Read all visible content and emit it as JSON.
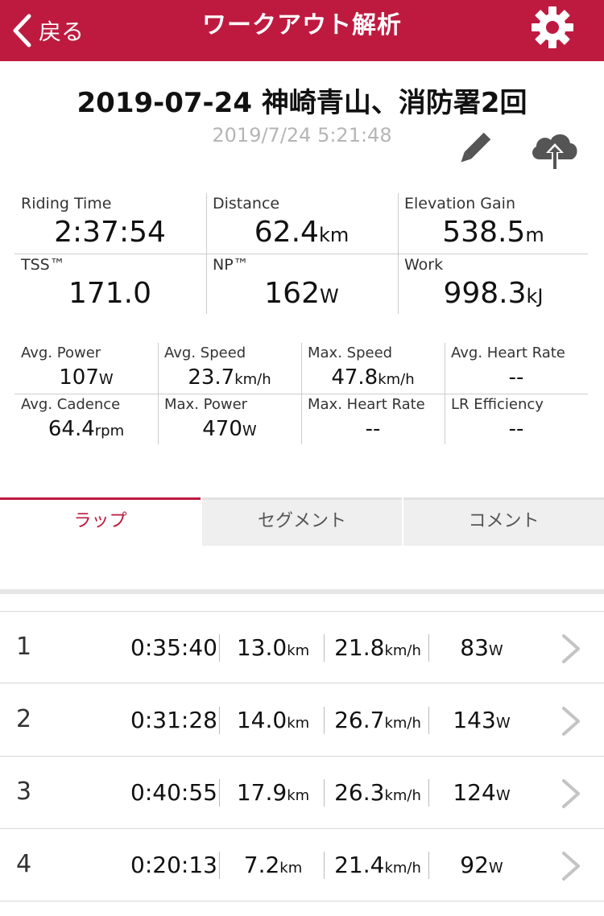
{
  "nav": {
    "back_label": "戻る",
    "title": "ワークアウト解析",
    "bar_color": "#be1a3f"
  },
  "workout": {
    "title": "2019-07-24 神崎青山、消防署2回",
    "datetime": "2019/7/24 5:21:48",
    "icons": [
      "pencil-icon",
      "cloud-upload-icon",
      "gear-icon"
    ]
  },
  "big_stats": [
    {
      "label": "Riding Time",
      "value": "2:37:54",
      "unit": ""
    },
    {
      "label": "Distance",
      "value": "62.4",
      "unit": "km"
    },
    {
      "label": "Elevation Gain",
      "value": "538.5",
      "unit": "m"
    },
    {
      "label": "TSS™",
      "value": "171.0",
      "unit": ""
    },
    {
      "label": "NP™",
      "value": "162",
      "unit": "W"
    },
    {
      "label": "Work",
      "value": "998.3",
      "unit": "kJ"
    }
  ],
  "small_stats": [
    {
      "label": "Avg. Power",
      "value": "107",
      "unit": "W"
    },
    {
      "label": "Avg. Speed",
      "value": "23.7",
      "unit": "km/h"
    },
    {
      "label": "Max. Speed",
      "value": "47.8",
      "unit": "km/h"
    },
    {
      "label": "Avg. Heart Rate",
      "value": "--",
      "unit": ""
    },
    {
      "label": "Avg. Cadence",
      "value": "64.4",
      "unit": "rpm"
    },
    {
      "label": "Max. Power",
      "value": "470",
      "unit": "W"
    },
    {
      "label": "Max. Heart Rate",
      "value": "--",
      "unit": ""
    },
    {
      "label": "LR Efficiency",
      "value": "--",
      "unit": ""
    }
  ],
  "tabs": [
    {
      "label": "ラップ",
      "active": true
    },
    {
      "label": "セグメント",
      "active": false
    },
    {
      "label": "コメント",
      "active": false
    }
  ],
  "laps": [
    {
      "num": "1",
      "time": "0:35:40",
      "dist": "13.0",
      "dist_unit": "km",
      "speed": "21.8",
      "speed_unit": "km/h",
      "power": "83",
      "power_unit": "W"
    },
    {
      "num": "2",
      "time": "0:31:28",
      "dist": "14.0",
      "dist_unit": "km",
      "speed": "26.7",
      "speed_unit": "km/h",
      "power": "143",
      "power_unit": "W"
    },
    {
      "num": "3",
      "time": "0:40:55",
      "dist": "17.9",
      "dist_unit": "km",
      "speed": "26.3",
      "speed_unit": "km/h",
      "power": "124",
      "power_unit": "W"
    },
    {
      "num": "4",
      "time": "0:20:13",
      "dist": "7.2",
      "dist_unit": "km",
      "speed": "21.4",
      "speed_unit": "km/h",
      "power": "92",
      "power_unit": "W"
    }
  ]
}
